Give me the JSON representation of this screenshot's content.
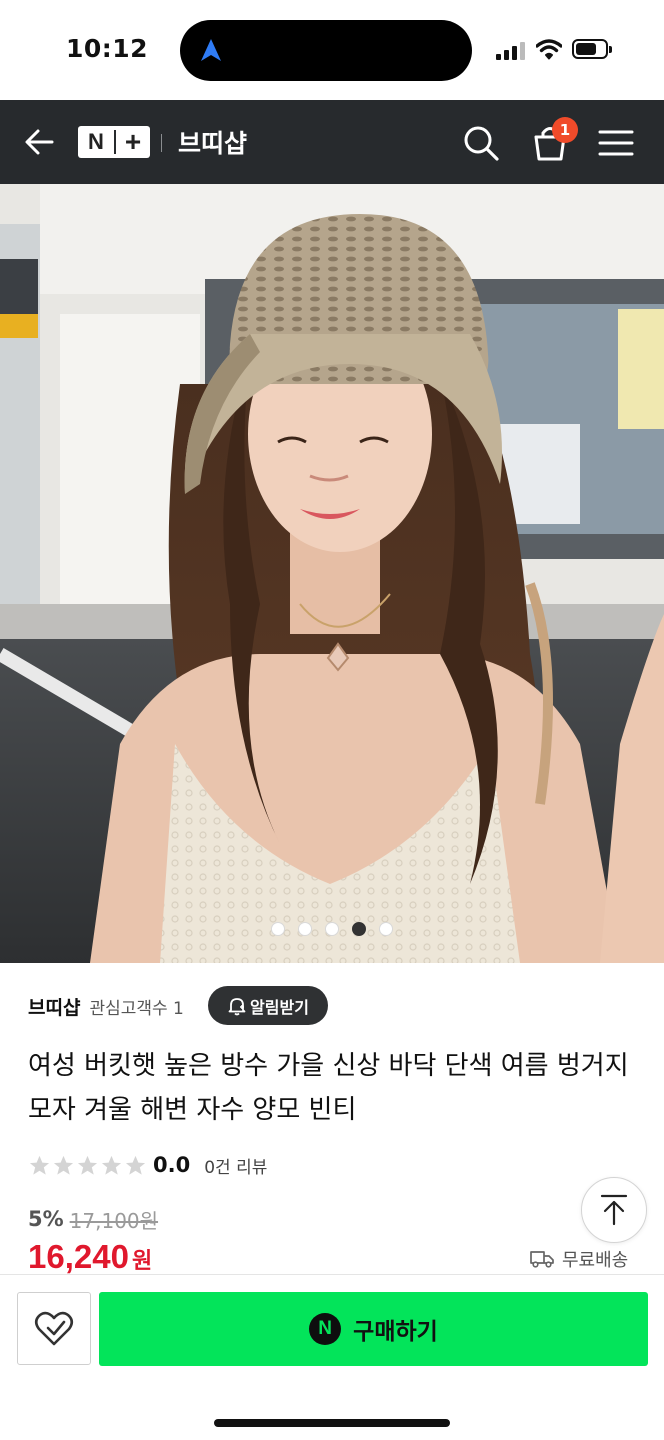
{
  "status_bar": {
    "time": "10:12"
  },
  "header": {
    "store_name": "브띠샵",
    "cart_count": "1",
    "logo": "N+"
  },
  "product_image": {
    "slide_count": 5,
    "active_slide": 4
  },
  "seller": {
    "name": "브띠샵",
    "follower_text": "관심고객수 1",
    "alert_label": "알림받기"
  },
  "product": {
    "title": "여성 버킷햇 높은 방수 가을 신상 바닥 단색 여름 벙거지 모자 겨울 해변 자수 양모 빈티",
    "rating": "0.0",
    "review_count": "0건 리뷰",
    "discount_percent": "5%",
    "original_price": "17,100원",
    "sale_price": "16,240",
    "sale_unit": "원",
    "shipping": "무료배송"
  },
  "bottom_bar": {
    "buy_label": "구매하기",
    "buy_icon_letter": "N"
  },
  "colors": {
    "buy_green": "#03e45a",
    "sale_red": "#e0182d",
    "header_bg": "#272a2d",
    "badge": "#f04b2a"
  },
  "icons": [
    "navigation-arrow-icon",
    "signal-icon",
    "wifi-icon",
    "battery-icon",
    "back-arrow-icon",
    "search-icon",
    "cart-icon",
    "menu-icon",
    "bell-icon",
    "star-icon",
    "truck-icon",
    "scroll-top-icon",
    "heart-icon"
  ]
}
